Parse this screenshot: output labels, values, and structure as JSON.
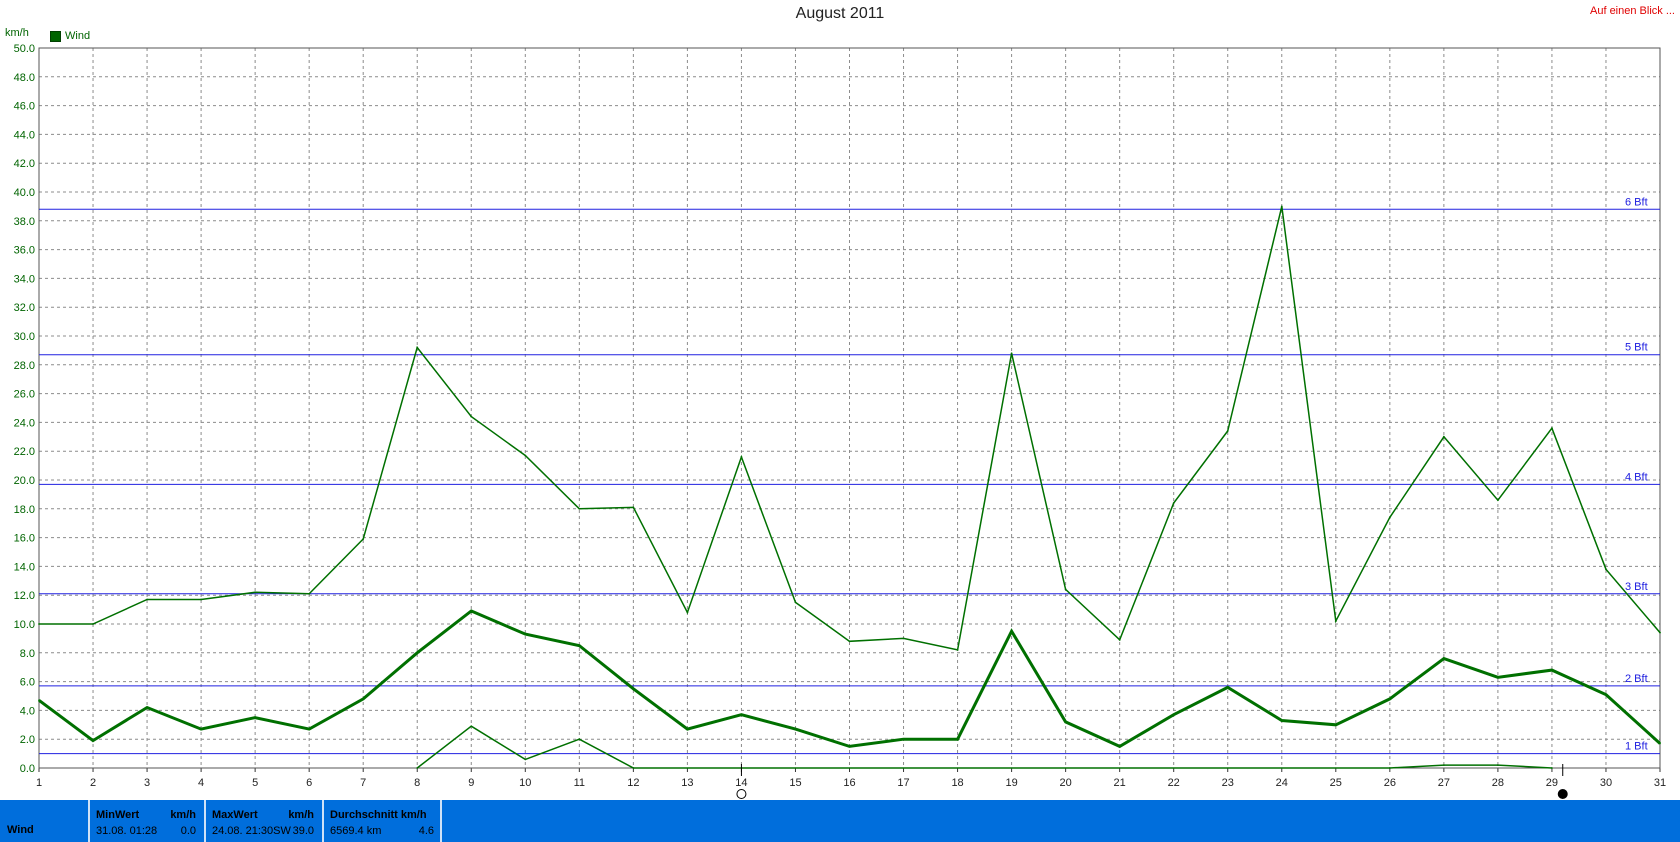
{
  "title": "August 2011",
  "top_link": "Auf einen Blick ...",
  "y_unit": "km/h",
  "legend": {
    "label": "Wind",
    "color": "#006400"
  },
  "chart_data": {
    "type": "line",
    "title": "August 2011",
    "ylabel": "km/h",
    "xlim": [
      1,
      31
    ],
    "ylim": [
      0,
      50
    ],
    "x_ticks": [
      1,
      2,
      3,
      4,
      5,
      6,
      7,
      8,
      9,
      10,
      11,
      12,
      13,
      14,
      15,
      16,
      17,
      18,
      19,
      20,
      21,
      22,
      23,
      24,
      25,
      26,
      27,
      28,
      29,
      30,
      31
    ],
    "y_ticks": [
      "0.0",
      "2.0",
      "4.0",
      "6.0",
      "8.0",
      "10.0",
      "12.0",
      "14.0",
      "16.0",
      "18.0",
      "20.0",
      "22.0",
      "24.0",
      "26.0",
      "28.0",
      "30.0",
      "32.0",
      "34.0",
      "36.0",
      "38.0",
      "40.0",
      "42.0",
      "44.0",
      "46.0",
      "48.0",
      "50.0"
    ],
    "grid": true,
    "legend_position": "top-left",
    "series": [
      {
        "name": "Wind",
        "color": "#007000",
        "width": 1.5,
        "x": [
          1,
          2,
          3,
          4,
          5,
          6,
          7,
          8,
          9,
          10,
          11,
          12,
          13,
          14,
          15,
          16,
          17,
          18,
          19,
          20,
          21,
          22,
          23,
          24,
          25,
          26,
          27,
          28,
          29,
          30,
          31
        ],
        "values": [
          10.0,
          10.0,
          11.7,
          11.7,
          12.2,
          12.1,
          15.9,
          29.2,
          24.4,
          21.7,
          18.0,
          18.1,
          10.8,
          21.6,
          11.5,
          8.8,
          9.0,
          8.2,
          28.8,
          12.4,
          8.9,
          18.4,
          23.4,
          39.0,
          10.2,
          17.4,
          23.0,
          18.6,
          23.6,
          13.8,
          9.4
        ]
      },
      {
        "color": "#007000",
        "width": 3,
        "x": [
          1,
          2,
          3,
          4,
          5,
          6,
          7,
          8,
          9,
          10,
          11,
          12,
          13,
          14,
          15,
          16,
          17,
          18,
          19,
          20,
          21,
          22,
          23,
          24,
          25,
          26,
          27,
          28,
          29,
          30,
          31
        ],
        "values": [
          4.7,
          1.9,
          4.2,
          2.7,
          3.5,
          2.7,
          4.8,
          8.0,
          10.9,
          9.3,
          8.5,
          5.5,
          2.7,
          3.7,
          2.7,
          1.5,
          2.0,
          2.0,
          9.5,
          3.2,
          1.5,
          3.7,
          5.6,
          3.3,
          3.0,
          4.8,
          7.6,
          6.3,
          6.8,
          5.1,
          1.7
        ]
      },
      {
        "color": "#007000",
        "width": 1.5,
        "x": [
          8,
          9,
          10,
          11,
          12,
          26,
          27,
          28,
          29
        ],
        "values": [
          0.0,
          2.9,
          0.6,
          2.0,
          0.0,
          0.0,
          0.2,
          0.2,
          0.0
        ]
      }
    ],
    "reference_lines": [
      {
        "label": "1 Bft",
        "y": 1.0
      },
      {
        "label": "2 Bft",
        "y": 5.7
      },
      {
        "label": "3 Bft",
        "y": 12.1
      },
      {
        "label": "4 Bft",
        "y": 19.7
      },
      {
        "label": "5 Bft",
        "y": 28.7
      },
      {
        "label": "6 Bft",
        "y": 38.8
      }
    ],
    "reference_color": "#2020e0",
    "moon_markers": [
      {
        "x": 14,
        "icon": "full-moon-icon"
      },
      {
        "x": 29.2,
        "icon": "new-moon-icon"
      }
    ]
  },
  "footer": {
    "row_label": "Wind",
    "min": {
      "header": "MinWert",
      "unit": "km/h",
      "when": "31.08.  01:28",
      "value": "0.0"
    },
    "max": {
      "header": "MaxWert",
      "unit": "km/h",
      "when": "24.08.  21:30SW",
      "value": "39.0"
    },
    "avg": {
      "header": "Durchschnitt km/h",
      "distance": "6569.4 km",
      "value": "4.6"
    }
  }
}
